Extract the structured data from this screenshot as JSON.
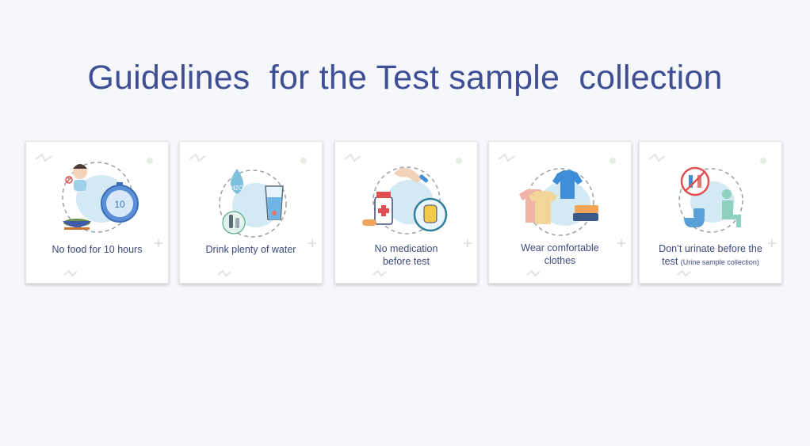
{
  "title": "Guidelines  for the Test sample  collection",
  "cards": [
    {
      "line1": "No food for 10 hours",
      "line2": "",
      "timer_label": "10"
    },
    {
      "line1": "Drink plenty of water",
      "line2": "",
      "badge": "H2O"
    },
    {
      "line1": "No medication",
      "line2": "before test"
    },
    {
      "line1": "Wear comfortable",
      "line2": "clothes"
    },
    {
      "line1": "Don’t urinate before the",
      "line2": "test",
      "note": "(Urine sample collection)"
    }
  ],
  "colors": {
    "title": "#3f4f96",
    "blob": "#d3eaf5",
    "accent_blue": "#3f8fd8",
    "decor": "#dfe3e8"
  },
  "icons": [
    "fasting-person-icon",
    "stopwatch-icon",
    "water-drop-icon",
    "water-glass-icon",
    "medicine-bottle-icon",
    "stop-hand-icon",
    "shirt-icon",
    "clothes-rack-icon",
    "no-restroom-icon",
    "toilet-icon"
  ]
}
